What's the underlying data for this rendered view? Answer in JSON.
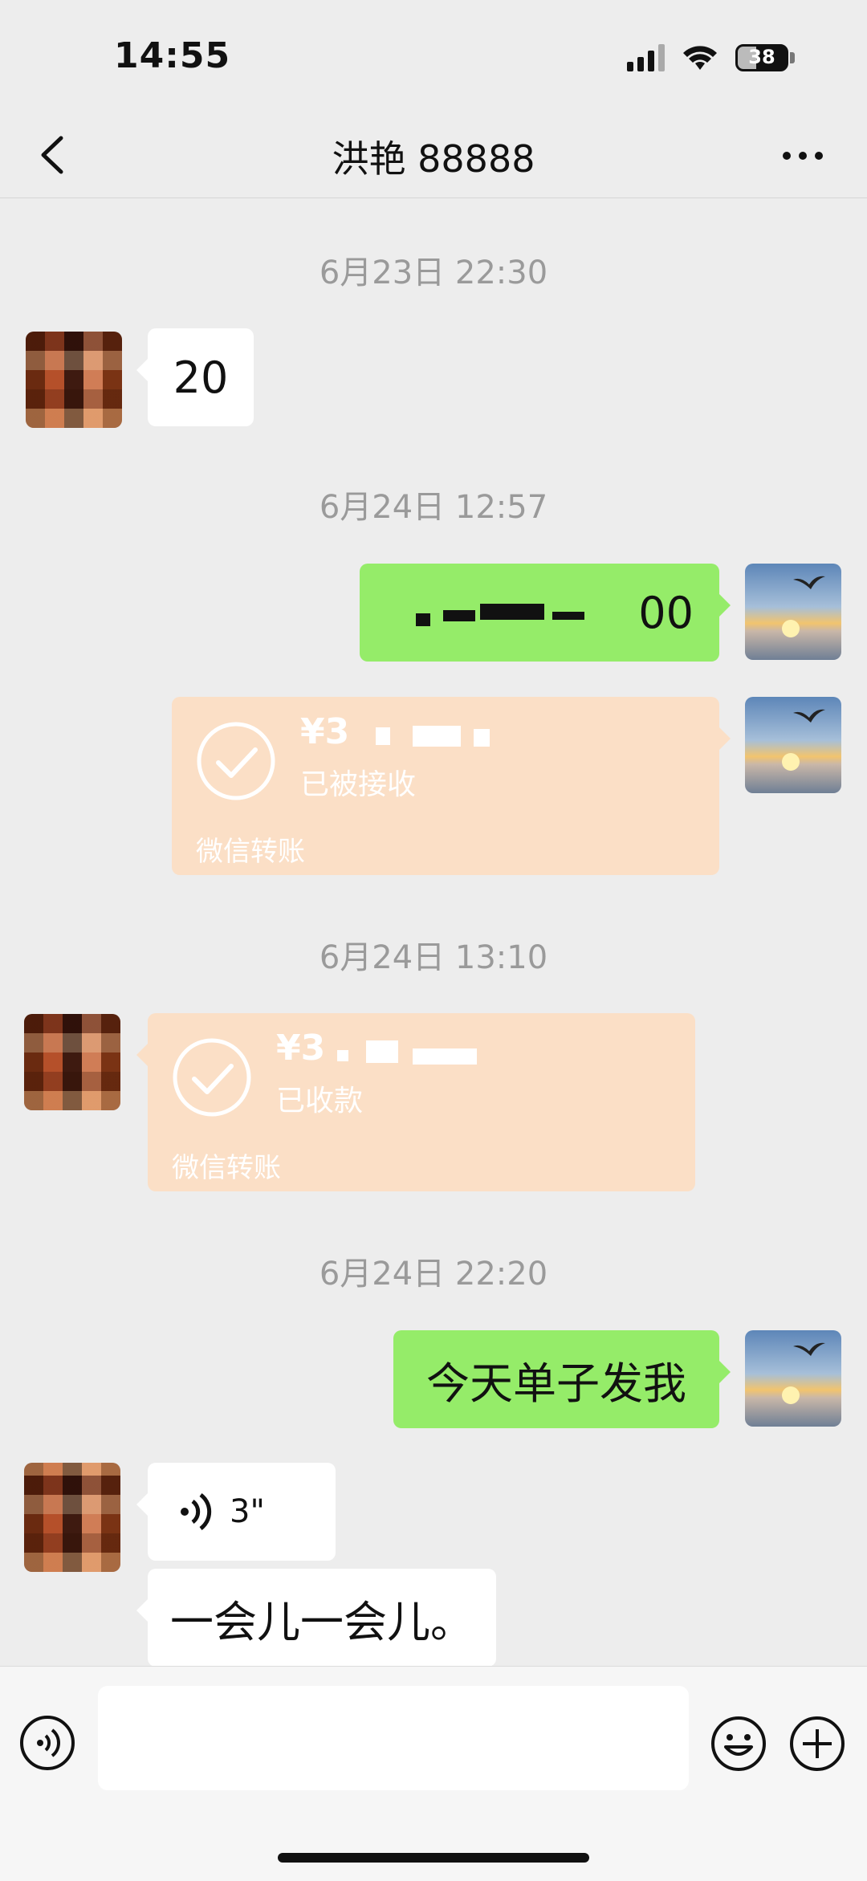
{
  "status_bar": {
    "time": "14:55",
    "battery": "38",
    "battery_level": 0.38
  },
  "nav": {
    "title": "洪艳 88888"
  },
  "messages": {
    "ts1": "6月23日 22:30",
    "m1_text": "20",
    "ts2": "6月24日 12:57",
    "m2_text": "00",
    "m3": {
      "amount": "¥3",
      "status": "已被接收",
      "footer": "微信转账"
    },
    "ts3": "6月24日 13:10",
    "m4": {
      "amount": "¥3",
      "status": "已收款",
      "footer": "微信转账"
    },
    "ts4": "6月24日 22:20",
    "m5_text": "今天单子发我",
    "m6_voice": "3\"",
    "m7_text": "一会儿一会儿。"
  },
  "colors": {
    "self_bubble": "#95ec69",
    "transfer": "#fbdfc6",
    "background": "#ededed"
  }
}
